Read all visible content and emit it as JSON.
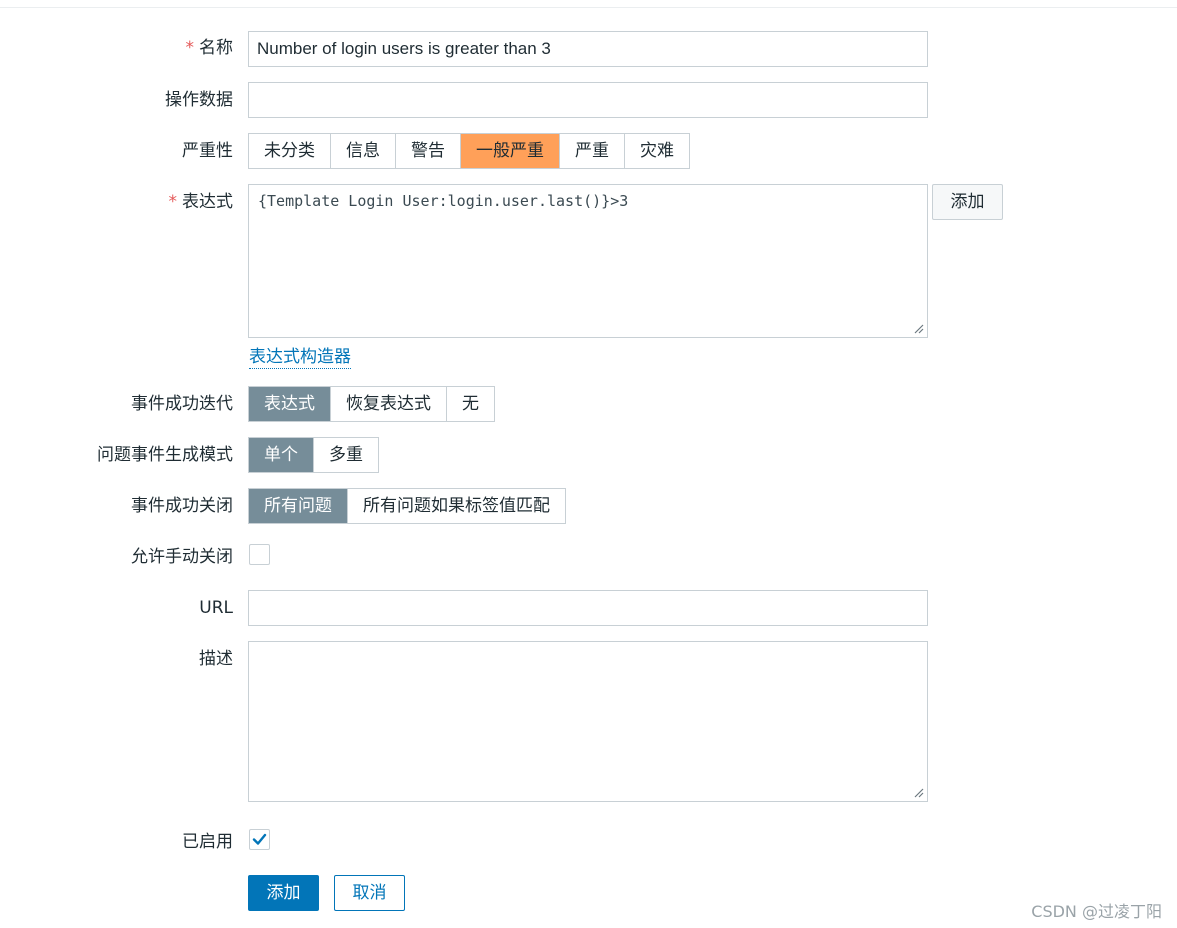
{
  "form": {
    "name": {
      "label": "名称",
      "value": "Number of login users is greater than 3"
    },
    "operational_data": {
      "label": "操作数据",
      "value": ""
    },
    "severity": {
      "label": "严重性",
      "options": [
        "未分类",
        "信息",
        "警告",
        "一般严重",
        "严重",
        "灾难"
      ],
      "selected": "一般严重"
    },
    "expression": {
      "label": "表达式",
      "value": "{Template Login User:login.user.last()}>3",
      "add_button": "添加",
      "constructor_link": "表达式构造器"
    },
    "ok_event_generation": {
      "label": "事件成功迭代",
      "options": [
        "表达式",
        "恢复表达式",
        "无"
      ],
      "selected": "表达式"
    },
    "problem_event_mode": {
      "label": "问题事件生成模式",
      "options": [
        "单个",
        "多重"
      ],
      "selected": "单个"
    },
    "ok_event_closes": {
      "label": "事件成功关闭",
      "options": [
        "所有问题",
        "所有问题如果标签值匹配"
      ],
      "selected": "所有问题"
    },
    "allow_manual_close": {
      "label": "允许手动关闭",
      "checked": false
    },
    "url": {
      "label": "URL",
      "value": ""
    },
    "description": {
      "label": "描述",
      "value": ""
    },
    "enabled": {
      "label": "已启用",
      "checked": true
    },
    "buttons": {
      "add": "添加",
      "cancel": "取消"
    }
  },
  "watermark": "CSDN @过凌丁阳",
  "colors": {
    "accent": "#0275b8",
    "severity_average": "#ffa059",
    "segment_selected": "#768d99",
    "required_mark": "#e45959"
  },
  "icons": {
    "resize_grip": "resize-grip-icon",
    "checkmark": "checkmark-icon"
  }
}
